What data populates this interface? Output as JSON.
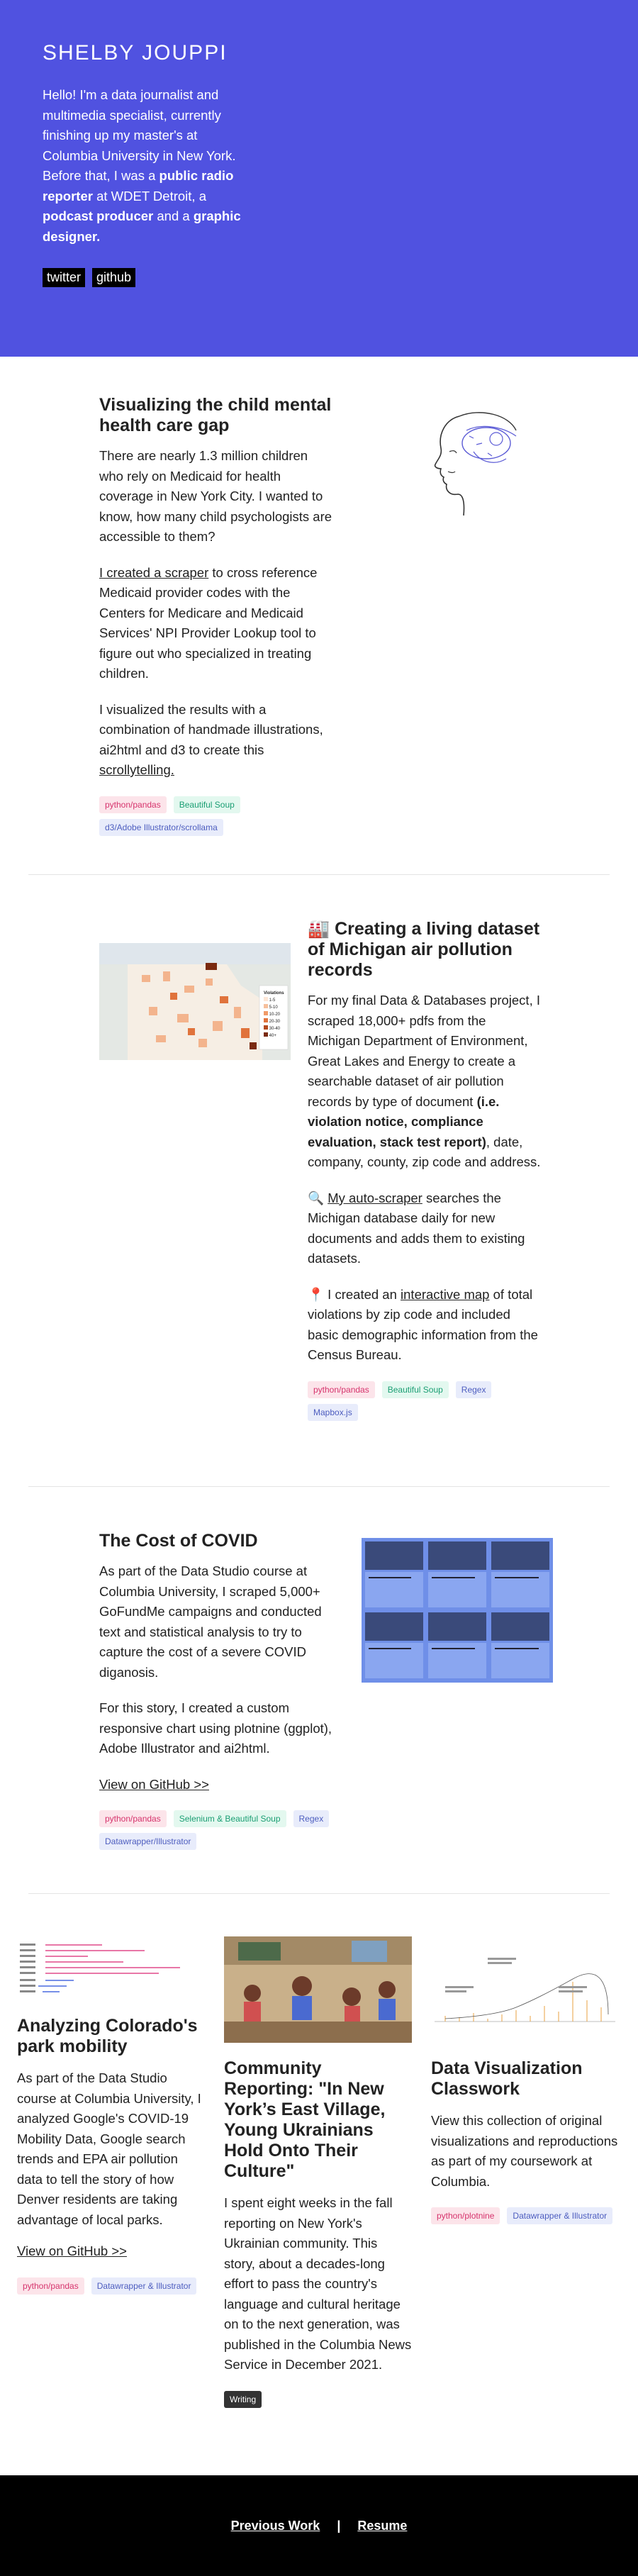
{
  "hero": {
    "name": "SHELBY JOUPPI",
    "bio_1": "Hello! I'm a data journalist and multimedia specialist, currently finishing up my master's at Columbia University in New York. Before that, I was a ",
    "bio_b1": "public radio reporter",
    "bio_2": " at WDET Detroit, a ",
    "bio_b2": "podcast producer",
    "bio_3": " and a ",
    "bio_b3": "graphic designer.",
    "links": [
      "twitter",
      "github"
    ]
  },
  "projects": {
    "p1": {
      "title": "Visualizing the child mental health care gap",
      "para1": "There are nearly 1.3 million children who rely on Medicaid for health coverage in New York City. I wanted to know, how many child psychologists are accessible to them?",
      "para2_link": "I created a scraper",
      "para2": " to cross reference Medicaid provider codes with the Centers for Medicare and Medicaid Services' NPI Provider Lookup tool to figure out who specialized in treating children.",
      "para3": "I visualized the results with a combination of handmade illustrations, ai2html and d3 to create this ",
      "para3_link": "scrollytelling.",
      "tags": [
        "python/pandas",
        "Beautiful Soup",
        "d3/Adobe Illustrator/scrollama"
      ]
    },
    "p2": {
      "icon": "🏭",
      "title": "Creating a living dataset of Michigan air pollution records",
      "para1a": "For my final Data & Databases project, I scraped 18,000+ pdfs from the Michigan Department of Environment, Great Lakes and Energy to create a searchable dataset of air pollution records by type of document ",
      "para1b": "(i.e. violation notice, compliance evaluation, stack test report)",
      "para1c": ", date, company, county, zip code and address.",
      "para2_icon": "🔍",
      "para2_link": "My auto-scraper",
      "para2": " searches the Michigan database daily for new documents and adds them to existing datasets.",
      "para3_icon": "📍",
      "para3a": " I created an ",
      "para3_link": "interactive map",
      "para3b": " of total violations by zip code and included basic demographic information from the Census Bureau.",
      "legend_title": "Violations",
      "legend_values": [
        "1-5",
        "5-10",
        "10-20",
        "20-30",
        "30-40",
        "40+"
      ],
      "tags": [
        "python/pandas",
        "Beautiful Soup",
        "Regex",
        "Mapbox.js"
      ]
    },
    "p3": {
      "title": "The Cost of COVID",
      "para1": "As part of the Data Studio course at Columbia University, I scraped 5,000+ GoFundMe campaigns and conducted text and statistical analysis to try to capture the cost of a severe COVID diganosis.",
      "para2": "For this story, I created a custom responsive chart using plotnine (ggplot), Adobe Illustrator and ai2html.",
      "link": "View on GitHub >>",
      "tags": [
        "python/pandas",
        "Selenium & Beautiful Soup",
        "Regex",
        "Datawrapper/Illustrator"
      ]
    }
  },
  "cards": [
    {
      "title": "Analyzing Colorado's park mobility",
      "text": "As part of the Data Studio course at Columbia University, I analyzed Google's COVID-19 Mobility Data, Google search trends and EPA air pollution data to tell the story of how Denver residents are taking advantage of local parks.",
      "link": "View on GitHub >>",
      "tags": [
        "python/pandas",
        "Datawrapper & Illustrator"
      ]
    },
    {
      "title": "Community Reporting: \"In New York’s East Village, Young Ukrainians Hold Onto Their Culture\"",
      "text": "I spent eight weeks in the fall reporting on New York's Ukrainian community. This story, about a decades-long effort to pass the country's language and cultural heritage on to the next generation, was published in the Columbia News Service in December 2021.",
      "tags": [
        "Writing"
      ]
    },
    {
      "title": "Data Visualization Classwork",
      "text": "View this collection of original visualizations and reproductions as part of my coursework at Columbia.",
      "tags": [
        "python/plotnine",
        "Datawrapper & Illustrator"
      ]
    }
  ],
  "footer": {
    "previous": "Previous Work",
    "separator": "|",
    "resume": "Resume"
  }
}
